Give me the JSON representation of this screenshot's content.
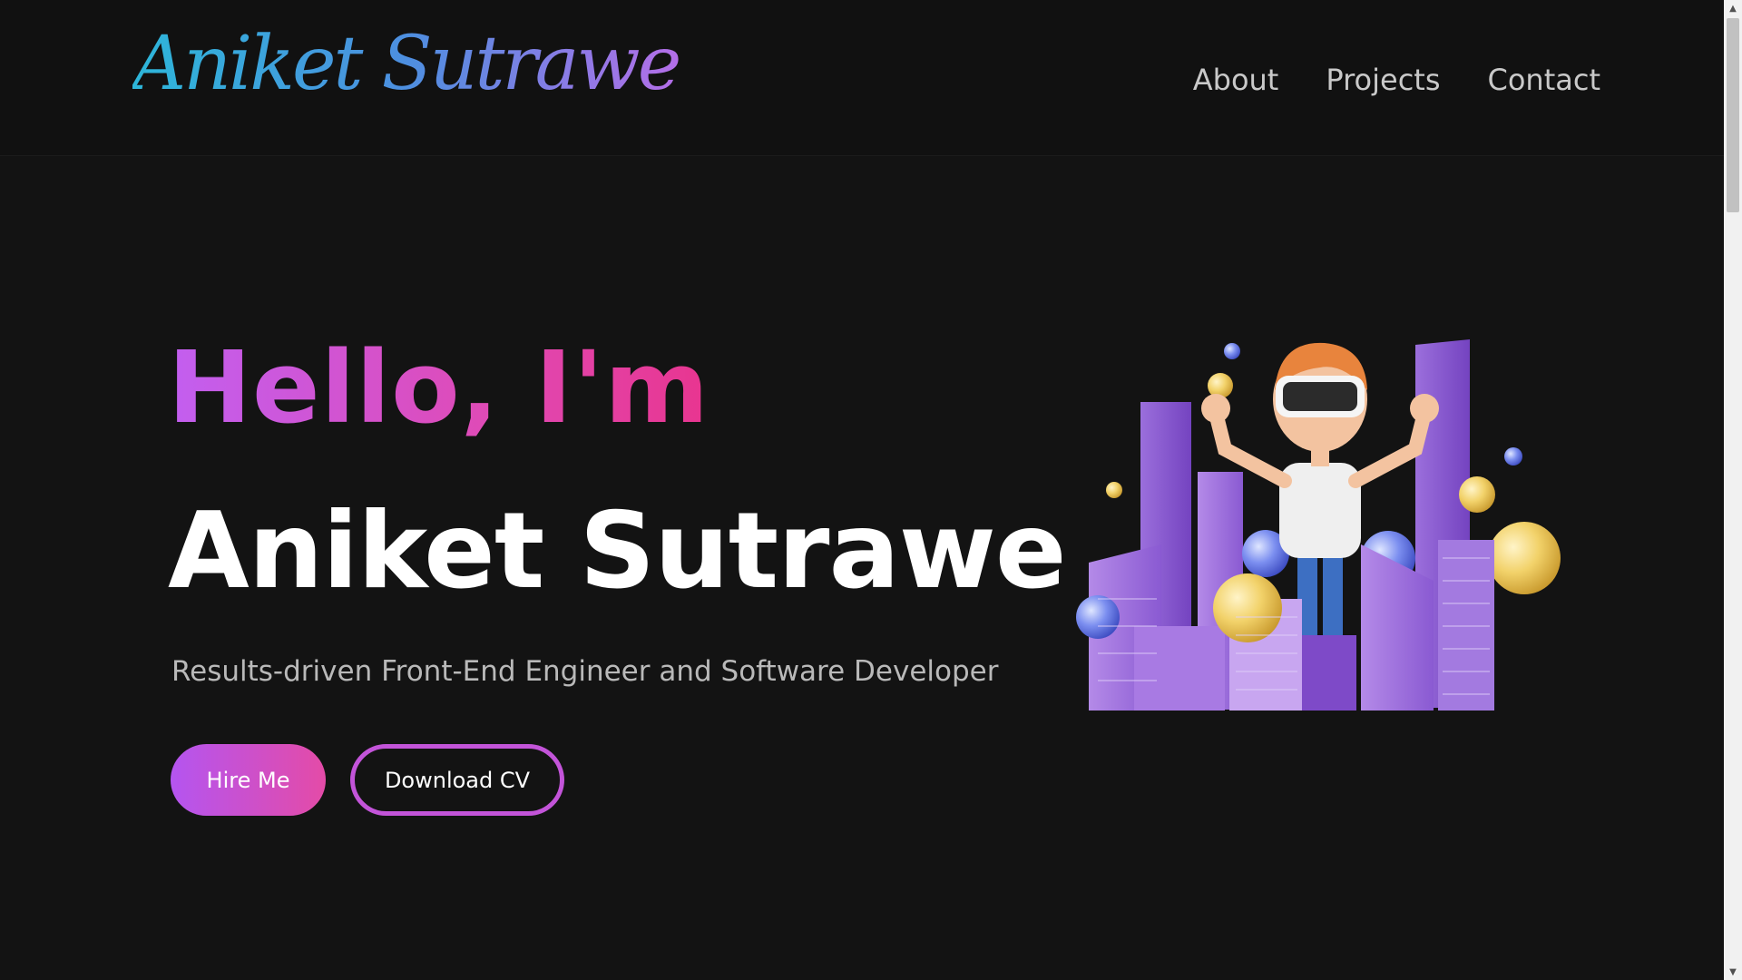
{
  "header": {
    "logo_text": "Aniket Sutrawe",
    "nav": {
      "about": "About",
      "projects": "Projects",
      "contact": "Contact"
    }
  },
  "hero": {
    "greeting": "Hello, I'm",
    "name": "Aniket Sutrawe",
    "tagline": "Results-driven Front-End Engineer and Software Developer",
    "hire_label": "Hire Me",
    "cv_label": "Download CV",
    "illustration_icon": "vr-character-city-illustration"
  },
  "scrollbar": {
    "up_icon": "scroll-up-arrow-icon",
    "down_icon": "scroll-down-arrow-icon"
  },
  "colors": {
    "background": "#131313",
    "header_background": "#111111",
    "logo_gradient_start": "#2db6d9",
    "logo_gradient_end": "#b46ee8",
    "greeting_gradient_start": "#c25ff0",
    "greeting_gradient_end": "#e8358f",
    "button_border": "#c354d9",
    "nav_text": "#c9c9c9",
    "tagline_text": "#b9b9b9"
  }
}
